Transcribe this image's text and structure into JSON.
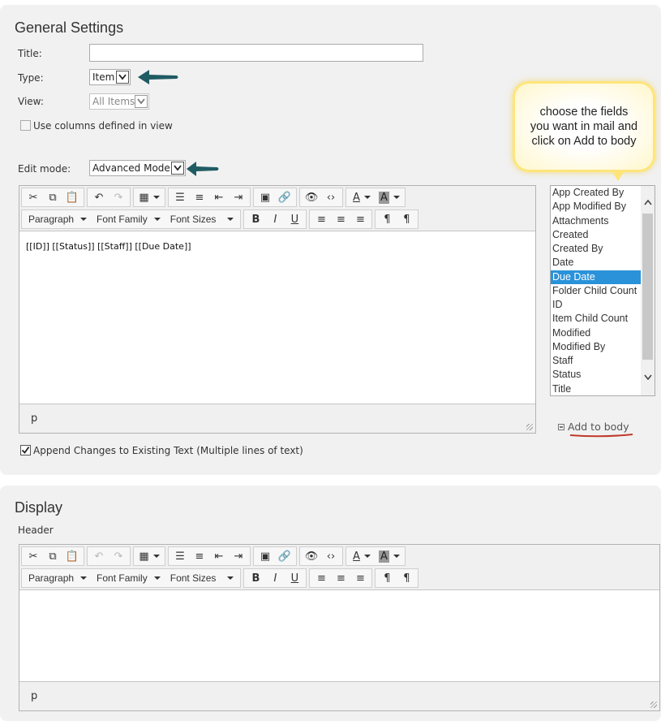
{
  "general": {
    "title": "General Settings",
    "title_label": "Title:",
    "title_value": "",
    "type_label": "Type:",
    "type_value": "Item",
    "view_label": "View:",
    "view_value": "All Items",
    "use_columns_label": "Use columns defined in view",
    "use_columns_checked": false,
    "edit_mode_label": "Edit mode:",
    "edit_mode_value": "Advanced Mode",
    "body_text": "[[ID]]   [[Status]]   [[Staff]]   [[Due Date]]",
    "status_path": "p",
    "append_changes_label": "Append Changes to Existing Text",
    "append_changes_note": "(Multiple lines of text)",
    "append_changes_checked": true
  },
  "toolbar": {
    "paragraph": "Paragraph",
    "font_family": "Font Family",
    "font_sizes": "Font Sizes",
    "buttons_row1": [
      "cut-icon",
      "copy-icon",
      "paste-icon",
      "undo-icon",
      "redo-icon",
      "table-icon",
      "bullet-list-icon",
      "numbered-list-icon",
      "outdent-icon",
      "indent-icon",
      "image-icon",
      "link-icon",
      "preview-icon",
      "source-code-icon",
      "font-color-icon",
      "background-color-icon"
    ],
    "buttons_row2": [
      "bold-icon",
      "italic-icon",
      "underline-icon",
      "align-left-icon",
      "align-center-icon",
      "align-right-icon",
      "ltr-icon",
      "rtl-icon"
    ]
  },
  "fields": {
    "items": [
      "App Created By",
      "App Modified By",
      "Attachments",
      "Created",
      "Created By",
      "Date",
      "Due Date",
      "Folder Child Count",
      "ID",
      "Item Child Count",
      "Modified",
      "Modified By",
      "Staff",
      "Status",
      "Title"
    ],
    "selected": "Due Date"
  },
  "callout": {
    "line1": "choose the fields",
    "line2": "you want in mail and",
    "line3": "click on Add to body"
  },
  "add_to_body": "Add to body",
  "display": {
    "title": "Display",
    "header_label": "Header",
    "status_path": "p"
  },
  "colors": {
    "accent_selected": "#2a92d9",
    "arrow": "#1f5b63",
    "underline_annotation": "#c0392b",
    "callout_border": "#ffe57a"
  }
}
